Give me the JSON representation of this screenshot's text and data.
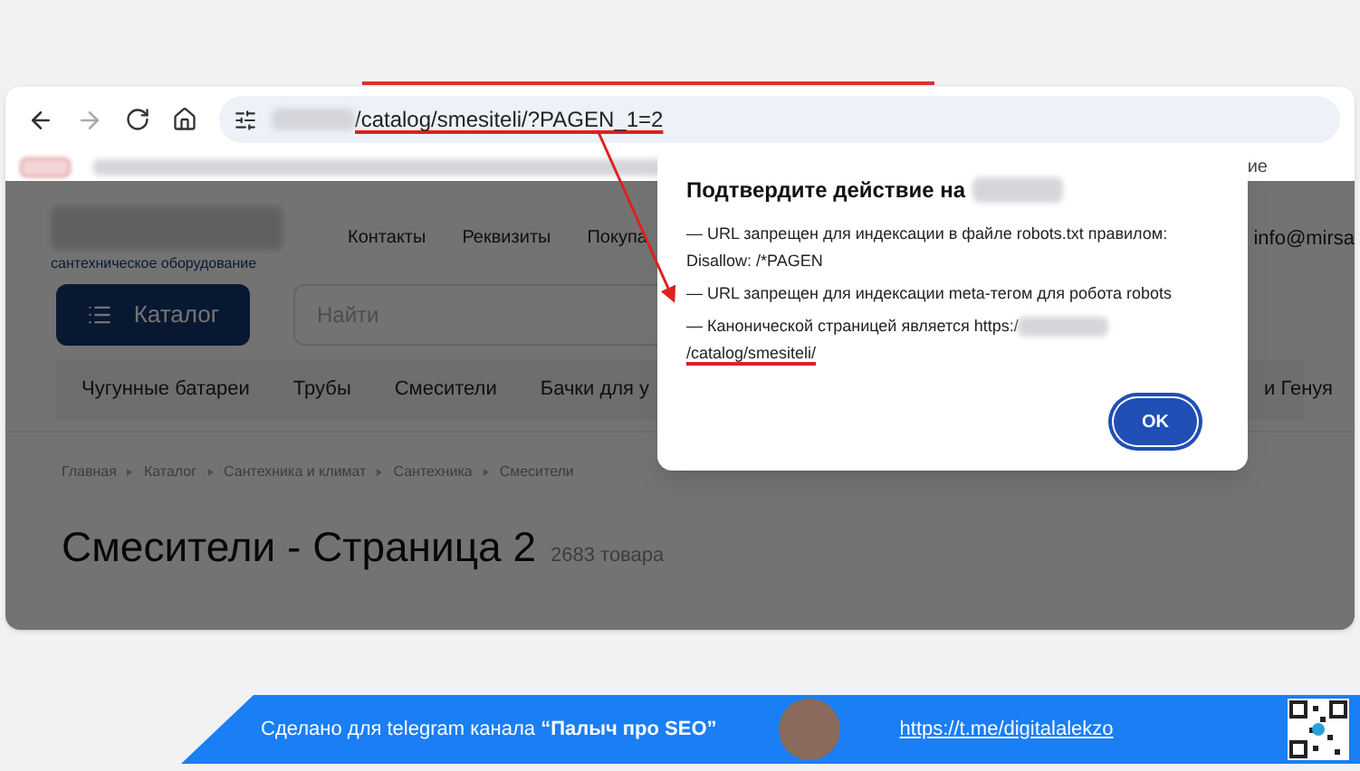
{
  "browser": {
    "url_path": "/catalog/smesiteli/?PAGEN_1=2",
    "bookmark_fragment": "ие"
  },
  "site": {
    "tagline": "сантехническое оборудование",
    "nav": [
      "Контакты",
      "Реквизиты",
      "Покупа"
    ],
    "email": "info@mirsa",
    "catalog_button": "Каталог",
    "search": {
      "placeholder": "Найти"
    },
    "categories": [
      "Чугунные батареи",
      "Трубы",
      "Смесители",
      "Бачки для у"
    ],
    "categories_right": "и Генуя",
    "breadcrumbs": [
      "Главная",
      "Каталог",
      "Сантехника и климат",
      "Сантехника",
      "Смесители"
    ],
    "title": "Смесители - Страница 2",
    "count": "2683 товара"
  },
  "dialog": {
    "title": "Подтвердите действие на",
    "lines": [
      "— URL запрещен для индексации в файле robots.txt правилом: Disallow: /*PAGEN",
      "— URL запрещен для индексации meta-тегом для робота robots"
    ],
    "canonical": {
      "text": "— Канонической страницей является https:/",
      "path": "/catalog/smesiteli/"
    },
    "button": "OK"
  },
  "banner": {
    "text": "Сделано для telegram канала **“Палыч про SEO”**",
    "link": "https://t.me/digitalalekzo"
  }
}
